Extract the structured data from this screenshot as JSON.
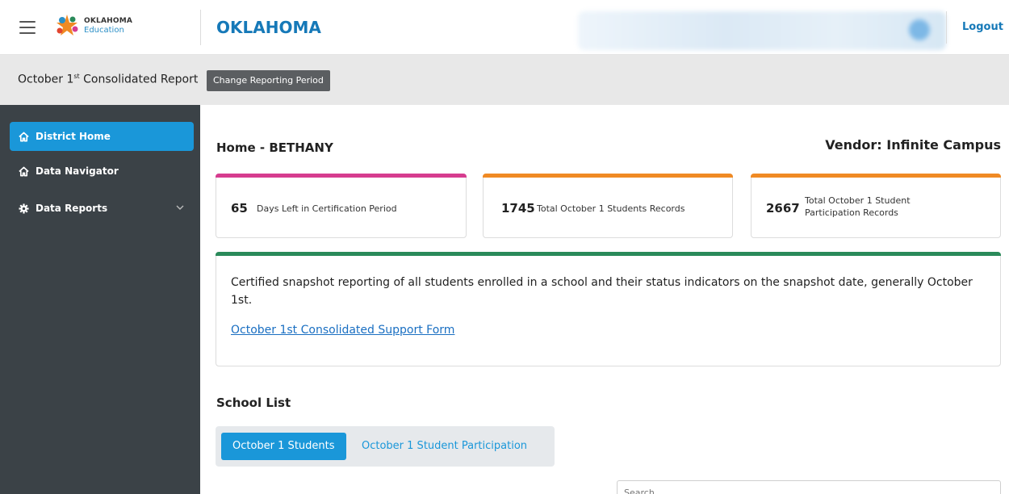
{
  "header": {
    "logo_line1": "OKLAHOMA",
    "logo_line2": "Education",
    "state_title": "OKLAHOMA",
    "logout_label": "Logout"
  },
  "subbar": {
    "report_title_prefix": "October 1",
    "report_title_sup": "st",
    "report_title_suffix": " Consolidated Report",
    "change_period_label": "Change Reporting Period"
  },
  "sidebar": {
    "items": [
      {
        "label": "District Home",
        "icon": "home-icon",
        "active": true
      },
      {
        "label": "Data Navigator",
        "icon": "home-icon",
        "active": false
      },
      {
        "label": "Data Reports",
        "icon": "gear-icon",
        "active": false,
        "expandable": true
      }
    ]
  },
  "main": {
    "home_title": "Home - BETHANY",
    "vendor": "Vendor: Infinite Campus",
    "cards": [
      {
        "value": "65",
        "label": "Days Left in Certification Period",
        "accent": "#d63c8f"
      },
      {
        "value": "1745",
        "label": "Total October 1 Students Records",
        "accent": "#f08a24"
      },
      {
        "value": "2667",
        "label": "Total October 1 Student Participation Records",
        "accent": "#f08a24"
      }
    ],
    "info": {
      "description": "Certified snapshot reporting of all students enrolled in a school and their status indicators on the snapshot date, generally October 1st.",
      "link_label": "October 1st Consolidated Support Form",
      "accent": "#2a8a5a"
    },
    "school_list": {
      "title": "School List",
      "tabs": [
        {
          "label": "October 1 Students",
          "active": true
        },
        {
          "label": "October 1 Student Participation",
          "active": false
        }
      ],
      "search_placeholder": "Search..."
    }
  },
  "colors": {
    "primary": "#1a97d9",
    "sidebar_bg": "#3b4247",
    "title_blue": "#1679b8"
  }
}
